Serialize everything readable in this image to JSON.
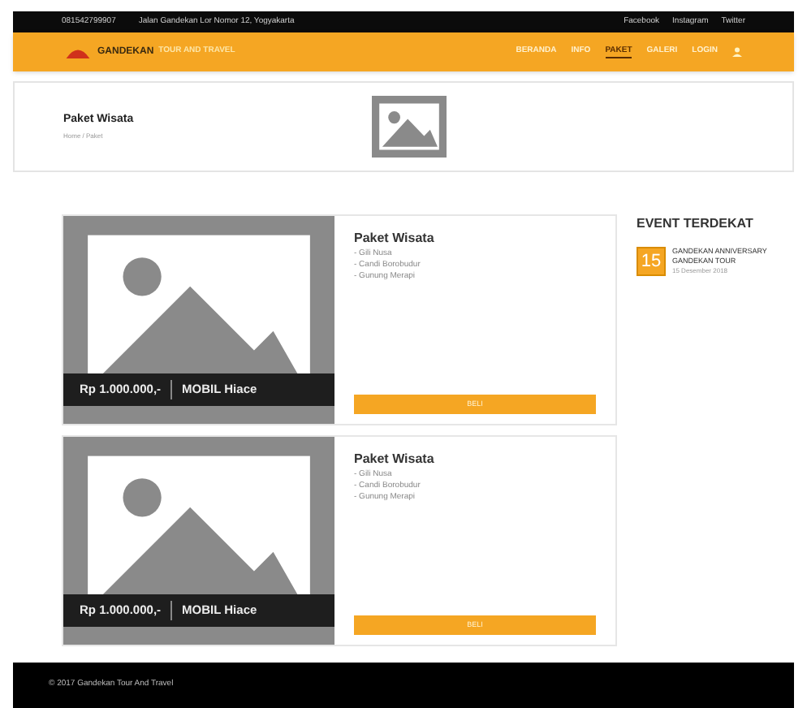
{
  "topbar": {
    "phone": "081542799907",
    "address": "Jalan Gandekan Lor Nomor 12, Yogyakarta",
    "social": [
      "Facebook",
      "Instagram",
      "Twitter"
    ]
  },
  "navbar": {
    "brand": "GANDEKAN",
    "tagline": "TOUR AND TRAVEL",
    "items": [
      {
        "label": "BERANDA",
        "selected": false
      },
      {
        "label": "INFO",
        "selected": false
      },
      {
        "label": "PAKET",
        "selected": true
      },
      {
        "label": "GALERI",
        "selected": false
      },
      {
        "label": "LOGIN",
        "selected": false
      }
    ]
  },
  "header": {
    "title": "Paket Wisata",
    "breadcrumb": "Home / Paket"
  },
  "packages": [
    {
      "price": "Rp 1.000.000,-",
      "vehicle": "MOBIL Hiace",
      "title": "Paket Wisata",
      "items": [
        "- Gili Nusa",
        "- Candi Borobudur",
        "- Gunung Merapi"
      ],
      "button": "BELI"
    },
    {
      "price": "Rp 1.000.000,-",
      "vehicle": "MOBIL Hiace",
      "title": "Paket Wisata",
      "items": [
        "- Gili Nusa",
        "- Candi Borobudur",
        "- Gunung Merapi"
      ],
      "button": "BELI"
    }
  ],
  "events": {
    "title": "EVENT TERDEKAT",
    "items": [
      {
        "day": "15",
        "name": "GANDEKAN ANNIVERSARY GANDEKAN TOUR",
        "date": "15 Desember 2018"
      }
    ]
  },
  "footer": "© 2017 Gandekan Tour And Travel"
}
